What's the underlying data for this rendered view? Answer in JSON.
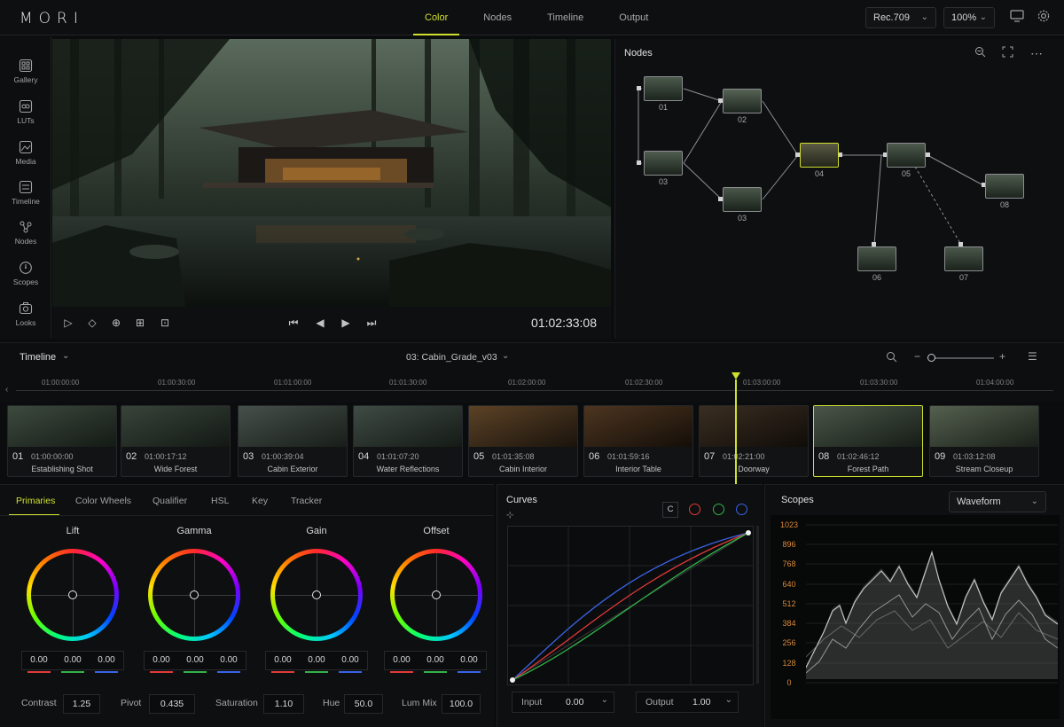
{
  "app": {
    "logo": "MORI"
  },
  "topbar": {
    "tabs": [
      {
        "label": "Color",
        "active": true
      },
      {
        "label": "Nodes"
      },
      {
        "label": "Timeline"
      },
      {
        "label": "Output"
      }
    ],
    "colorspace": "Rec.709",
    "zoom": "100%"
  },
  "sidebar": {
    "items": [
      {
        "label": "Gallery",
        "icon": "gallery-icon"
      },
      {
        "label": "LUTs",
        "icon": "lut-icon"
      },
      {
        "label": "Media",
        "icon": "media-icon"
      },
      {
        "label": "Timeline",
        "icon": "timeline-icon"
      },
      {
        "label": "Nodes",
        "icon": "nodes-icon"
      },
      {
        "label": "Scopes",
        "icon": "scopes-icon"
      },
      {
        "label": "Looks",
        "icon": "looks-icon"
      }
    ]
  },
  "viewer": {
    "timecode": "01:02:33:08"
  },
  "nodes_panel": {
    "title": "Nodes",
    "nodes": [
      "01",
      "02",
      "03",
      "03",
      "04",
      "05",
      "08",
      "06",
      "07"
    ],
    "selected": "04"
  },
  "timeline": {
    "title": "Timeline",
    "sequence": "03: Cabin_Grade_v03",
    "ruler": [
      "01:00:00:00",
      "01:00:30:00",
      "01:01:00:00",
      "01:01:30:00",
      "01:02:00:00",
      "01:02:30:00",
      "01:03:00:00",
      "01:03:30:00",
      "01:04:00:00"
    ],
    "clips": [
      {
        "num": "01",
        "tc": "01:00:00:00",
        "name": "Establishing Shot"
      },
      {
        "num": "02",
        "tc": "01:00:17:12",
        "name": "Wide Forest"
      },
      {
        "num": "03",
        "tc": "01:00:39:04",
        "name": "Cabin Exterior"
      },
      {
        "num": "04",
        "tc": "01:01:07:20",
        "name": "Water Reflections"
      },
      {
        "num": "05",
        "tc": "01:01:35:08",
        "name": "Cabin Interior"
      },
      {
        "num": "06",
        "tc": "01:01:59:16",
        "name": "Interior Table"
      },
      {
        "num": "07",
        "tc": "01:02:21:00",
        "name": "Doorway"
      },
      {
        "num": "08",
        "tc": "01:02:46:12",
        "name": "Forest Path",
        "active": true
      },
      {
        "num": "09",
        "tc": "01:03:12:08",
        "name": "Stream Closeup"
      }
    ]
  },
  "primaries": {
    "tabs": [
      {
        "label": "Primaries",
        "active": true
      },
      {
        "label": "Color Wheels"
      },
      {
        "label": "Qualifier"
      },
      {
        "label": "HSL"
      },
      {
        "label": "Key"
      },
      {
        "label": "Tracker"
      }
    ],
    "wheels": [
      {
        "title": "Lift",
        "values": [
          "0.00",
          "0.00",
          "0.00"
        ]
      },
      {
        "title": "Gamma",
        "values": [
          "0.00",
          "0.00",
          "0.00"
        ]
      },
      {
        "title": "Gain",
        "values": [
          "0.00",
          "0.00",
          "0.00"
        ]
      },
      {
        "title": "Offset",
        "values": [
          "0.00",
          "0.00",
          "0.00"
        ]
      }
    ],
    "params": [
      {
        "label": "Contrast",
        "value": "1.25"
      },
      {
        "label": "Pivot",
        "value": "0.435"
      },
      {
        "label": "Saturation",
        "value": "1.10"
      },
      {
        "label": "Hue",
        "value": "50.0"
      },
      {
        "label": "Lum Mix",
        "value": "100.0"
      }
    ]
  },
  "curves": {
    "title": "Curves",
    "channel_c": "C",
    "input_label": "Input",
    "input_value": "0.00",
    "output_label": "Output",
    "output_value": "1.00"
  },
  "scopes": {
    "title": "Scopes",
    "mode": "Waveform",
    "levels": [
      "1023",
      "896",
      "768",
      "640",
      "512",
      "384",
      "256",
      "128",
      "0"
    ]
  },
  "colors": {
    "accent": "#cfe02e",
    "red": "#e23a3a",
    "green": "#33b34a",
    "blue": "#3a63e6"
  }
}
